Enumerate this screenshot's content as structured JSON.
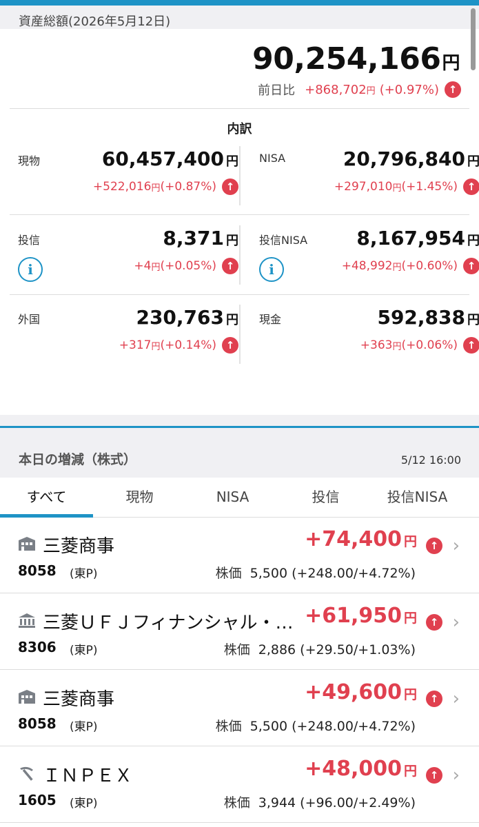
{
  "header": {
    "title": "資産総額(2026年5月12日)"
  },
  "total": {
    "amount": "90,254,166",
    "unit": "円",
    "day_label": "前日比",
    "day_change": "+868,702",
    "day_pct": "(+0.97%)",
    "day_unit": "円"
  },
  "breakdown": {
    "title": "内訳",
    "items": [
      {
        "name": "現物",
        "amount": "60,457,400",
        "change": "+522,016",
        "pct": "(+0.87%)"
      },
      {
        "name": "NISA",
        "amount": "20,796,840",
        "change": "+297,010",
        "pct": "(+1.45%)"
      },
      {
        "name": "投信",
        "amount": "8,371",
        "change": "+4",
        "pct": "(+0.05%)"
      },
      {
        "name": "投信NISA",
        "amount": "8,167,954",
        "change": "+48,992",
        "pct": "(+0.60%)"
      },
      {
        "name": "外国",
        "amount": "230,763",
        "change": "+317",
        "pct": "(+0.14%)"
      },
      {
        "name": "現金",
        "amount": "592,838",
        "change": "+363",
        "pct": "(+0.06%)"
      }
    ],
    "unit": "円"
  },
  "section": {
    "title": "本日の増減（株式）",
    "time": "5/12 16:00"
  },
  "tabs": [
    "すべて",
    "現物",
    "NISA",
    "投信",
    "投信NISA"
  ],
  "stocks": [
    {
      "name": "三菱商事",
      "code": "8058",
      "market": "(東P)",
      "gain": "+74,400",
      "price_label": "株価",
      "price": "5,500 (+248.00/+4.72%)",
      "icon": "building-icon"
    },
    {
      "name": "三菱ＵＦＪフィナンシャル・…",
      "code": "8306",
      "market": "(東P)",
      "gain": "+61,950",
      "price_label": "株価",
      "price": "2,886 (+29.50/+1.03%)",
      "icon": "bank-icon"
    },
    {
      "name": "三菱商事",
      "code": "8058",
      "market": "(東P)",
      "gain": "+49,600",
      "price_label": "株価",
      "price": "5,500 (+248.00/+4.72%)",
      "icon": "building-icon"
    },
    {
      "name": "ＩＮＰＥＸ",
      "code": "1605",
      "market": "(東P)",
      "gain": "+48,000",
      "price_label": "株価",
      "price": "3,944 (+96.00/+2.49%)",
      "icon": "pickaxe-icon"
    }
  ],
  "colors": {
    "accent": "#1e93c6",
    "gain": "#e0404f"
  }
}
